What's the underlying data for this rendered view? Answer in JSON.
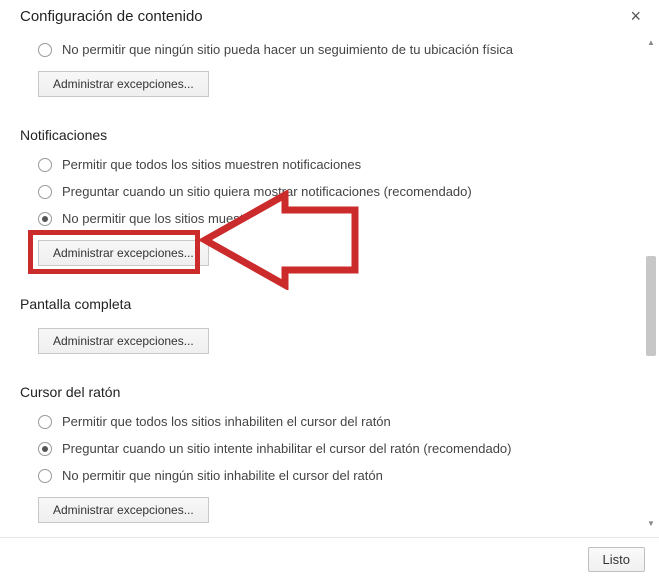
{
  "dialog": {
    "title": "Configuración de contenido",
    "close_label": "×"
  },
  "tracking": {
    "options": [
      {
        "label": "No permitir que ningún sitio pueda hacer un seguimiento de tu ubicación física",
        "selected": false
      }
    ],
    "manage_label": "Administrar excepciones..."
  },
  "notifications": {
    "heading": "Notificaciones",
    "options": [
      {
        "label": "Permitir que todos los sitios muestren notificaciones",
        "selected": false
      },
      {
        "label": "Preguntar cuando un sitio quiera mostrar notificaciones (recomendado)",
        "selected": false
      },
      {
        "label": "No permitir que los sitios muestren notificaciones",
        "selected": true
      }
    ],
    "manage_label": "Administrar excepciones..."
  },
  "fullscreen": {
    "heading": "Pantalla completa",
    "manage_label": "Administrar excepciones..."
  },
  "mouse": {
    "heading": "Cursor del ratón",
    "options": [
      {
        "label": "Permitir que todos los sitios inhabiliten el cursor del ratón",
        "selected": false
      },
      {
        "label": "Preguntar cuando un sitio intente inhabilitar el cursor del ratón (recomendado)",
        "selected": true
      },
      {
        "label": "No permitir que ningún sitio inhabilite el cursor del ratón",
        "selected": false
      }
    ],
    "manage_label": "Administrar excepciones..."
  },
  "footer": {
    "done_label": "Listo"
  },
  "annotation": {
    "color": "#cc2b2b"
  }
}
